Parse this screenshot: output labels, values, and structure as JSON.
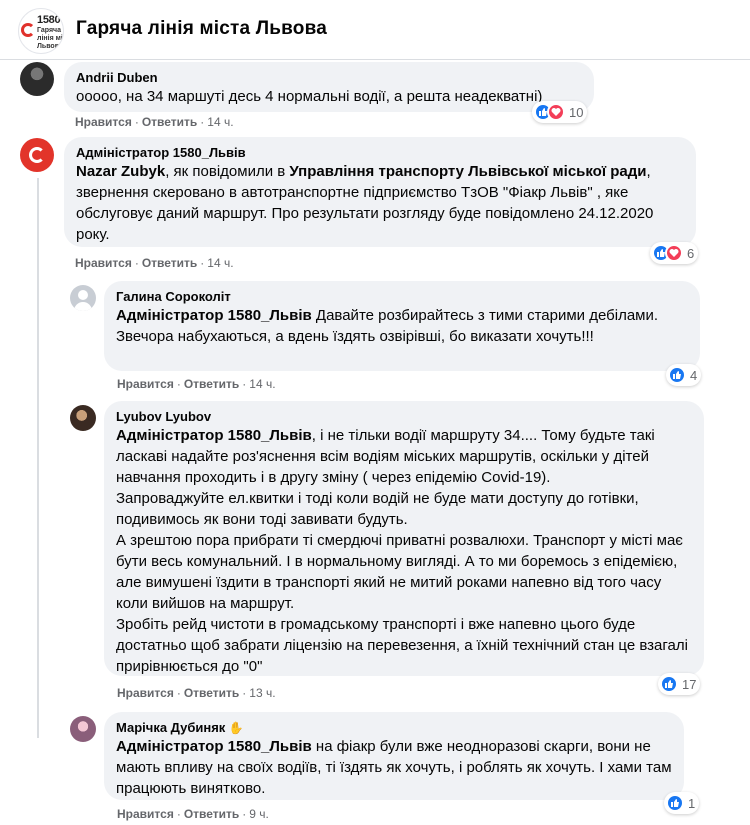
{
  "header": {
    "page_title": "Гаряча лінія міста Львова",
    "logo_number": "1580",
    "logo_subtitle": "Гаряча лінія міста Львова"
  },
  "actions": {
    "like_label": "Нравится",
    "reply_label": "Ответить",
    "separator": "·"
  },
  "comments": [
    {
      "author": "Andrii Duben",
      "text": "ооооо, на 34 маршуті десь 4 нормальні водії, а решта неадекватні)",
      "time": "14 ч.",
      "reactions": [
        "like",
        "love"
      ],
      "reaction_count": "10"
    },
    {
      "author": "Адміністратор 1580_Львів",
      "mention": "Nazar Zubyk",
      "text_1": ", як повідомили в ",
      "org": "Управління транспорту Львівської міської ради",
      "text_2": ", звернення скеровано в автотранспортне підприємство ТзОВ \"Фіакр Львів\" , яке обслуговує даний маршрут. Про результати розгляду буде повідомлено 24.12.2020 року.",
      "time": "14 ч.",
      "reactions": [
        "like",
        "love"
      ],
      "reaction_count": "6"
    },
    {
      "author": "Галина Сороколіт",
      "mention": "Адміністратор 1580_Львів",
      "text": " Давайте розбирайтесь з тими старими дебілами. Звечора набухаються, а вдень їздять озвірівші, бо виказати хочуть!!!",
      "time": "14 ч.",
      "reactions": [
        "like"
      ],
      "reaction_count": "4"
    },
    {
      "author": "Lyubov Lyubov",
      "mention": "Адміністратор 1580_Львів",
      "text_1": ", і не тільки водії маршруту 34.... Тому будьте такі ласкаві надайте роз'яснення всім водіям міських маршрутів, оскільки у дітей навчання проходить і в другу зміну ( через епідемію Covid-19).",
      "text_2": "Запроваджуйте ел.квитки і тоді коли водій не буде мати доступу до готівки, подивимось як вони тоді завивати будуть.",
      "text_3": "А зрештою пора прибрати ті смердючі приватні розвалюхи. Транспорт у місті має бути весь комунальний. І в нормальному вигляді. А то ми боремось з епідемією, але вимушені їздити в транспорті який не митий роками напевно від того часу коли вийшов на маршрут.",
      "text_4": "Зробіть рейд чистоти в громадському транспорті і вже напевно цього буде достатньо щоб забрати ліцензію на перевезення, а їхній технічний стан це взагалі прирівнюється до \"0\"",
      "time": "13 ч.",
      "reactions": [
        "like"
      ],
      "reaction_count": "17"
    },
    {
      "author": "Марічка Дубиняк",
      "mention": "Адміністратор 1580_Львів",
      "text": " на фіакр були вже неодноразові скарги, вони не мають впливу на своїх водіїв, ті їздять як хочуть, і роблять як хочуть. І хами там працюють винятково.",
      "time": "9 ч.",
      "reactions": [
        "like"
      ],
      "reaction_count": "1"
    }
  ],
  "colors": {
    "bubble": "#f0f2f5",
    "like": "#1877f2",
    "love": "#f33e58",
    "meta": "#65676b"
  }
}
